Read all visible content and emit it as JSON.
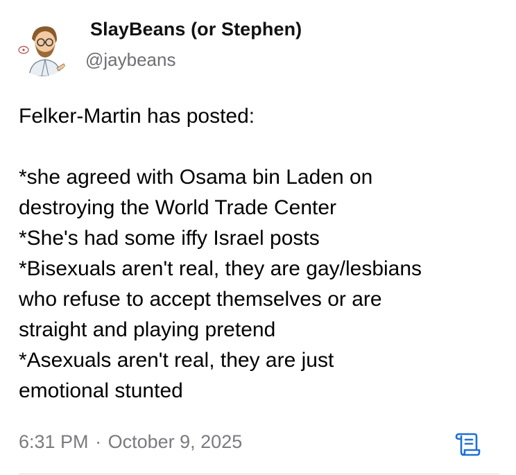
{
  "author": {
    "display_name": "SlayBeans (or Stephen)",
    "handle": "@jaybeans",
    "avatar_icon": "cartoon-avatar-icon"
  },
  "post": {
    "lines": [
      "Felker-Martin has posted:",
      "",
      "*she agreed with Osama bin Laden on",
      "destroying the World Trade Center",
      "*She's had some iffy Israel posts",
      "*Bisexuals aren't real, they are gay/lesbians",
      "who refuse to accept themselves or are",
      "straight and playing pretend",
      "*Asexuals aren't real, they are just",
      "emotional stunted"
    ]
  },
  "meta": {
    "time": "6:31 PM",
    "separator": "·",
    "date": "October 9, 2025",
    "thread_icon": "scroll-icon"
  },
  "colors": {
    "text": "#000000",
    "secondary": "#7a7a7f",
    "accent": "#1d6fd8"
  }
}
